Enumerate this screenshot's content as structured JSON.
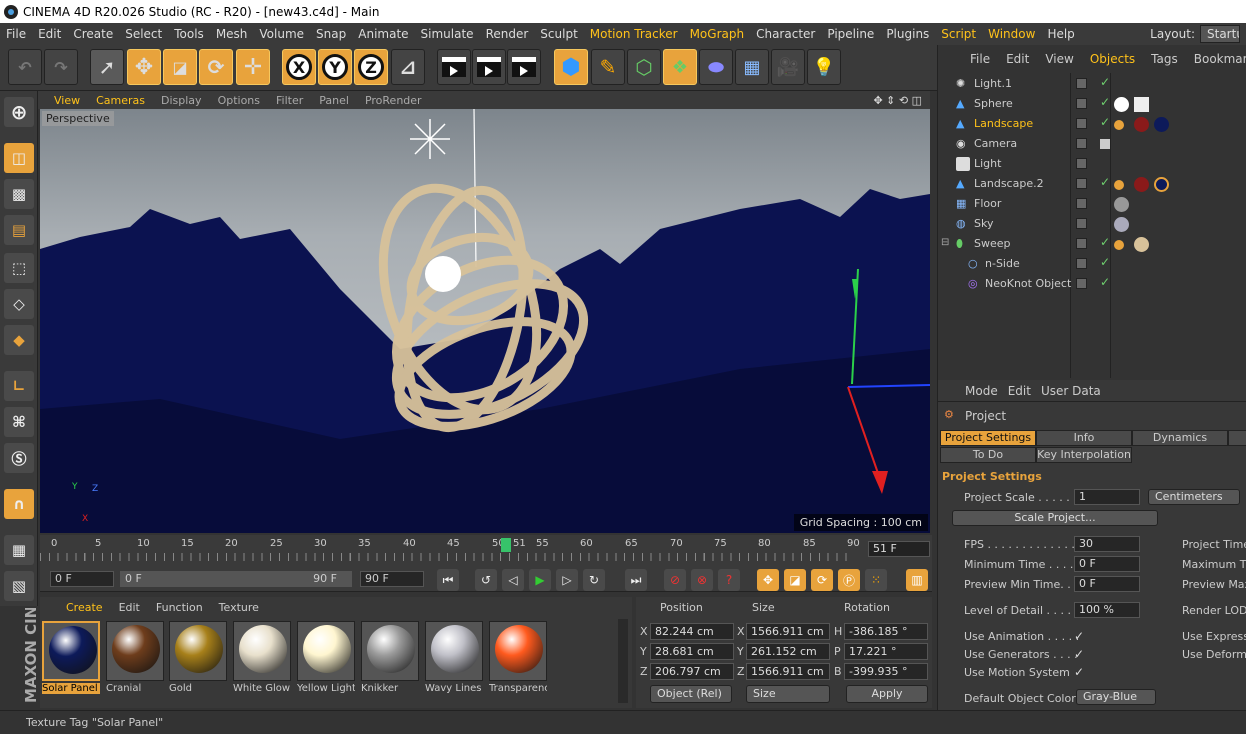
{
  "title": "CINEMA 4D R20.026 Studio (RC - R20) - [new43.c4d] - Main",
  "menu": [
    "File",
    "Edit",
    "Create",
    "Select",
    "Tools",
    "Mesh",
    "Volume",
    "Snap",
    "Animate",
    "Simulate",
    "Render",
    "Sculpt",
    "Motion Tracker",
    "MoGraph",
    "Character",
    "Pipeline",
    "Plugins",
    "Script",
    "Window",
    "Help"
  ],
  "layout": {
    "label": "Layout:",
    "value": "Startup"
  },
  "toolbar_axes": [
    "X",
    "Y",
    "Z"
  ],
  "viewport": {
    "menu": [
      "View",
      "Cameras",
      "Display",
      "Options",
      "Filter",
      "Panel",
      "ProRender"
    ],
    "camera": "Perspective",
    "grid_spacing": "Grid Spacing : 100 cm"
  },
  "timeline": {
    "ticks": [
      "0",
      "5",
      "10",
      "15",
      "20",
      "25",
      "30",
      "35",
      "40",
      "45",
      "50",
      "51",
      "55",
      "60",
      "65",
      "70",
      "75",
      "80",
      "85",
      "90"
    ],
    "current": "51 F",
    "start": "0 F",
    "slider_start": "0 F",
    "slider_end": "90 F",
    "end": "90 F"
  },
  "materials": {
    "menu": [
      "Create",
      "Edit",
      "Function",
      "Texture"
    ],
    "items": [
      {
        "name": "Solar Panel",
        "color": "#0d1a5a"
      },
      {
        "name": "Cranial",
        "color": "#6e3d1c"
      },
      {
        "name": "Gold",
        "color": "#a7801a"
      },
      {
        "name": "White Glow",
        "color": "#e8e0cc"
      },
      {
        "name": "Yellow Light",
        "color": "#fff6d0"
      },
      {
        "name": "Knikker",
        "color": "#9b9b9b"
      },
      {
        "name": "Wavy Lines",
        "color": "#c0c0c8"
      },
      {
        "name": "Transparency",
        "color": "#ff5a1e"
      }
    ]
  },
  "coords": {
    "headers": [
      "Position",
      "Size",
      "Rotation"
    ],
    "rows": [
      {
        "axis": "X",
        "pos": "82.244 cm",
        "saxis": "X",
        "size": "1566.911 cm",
        "raxis": "H",
        "rot": "-386.185 °"
      },
      {
        "axis": "Y",
        "pos": "28.681 cm",
        "saxis": "Y",
        "size": "261.152 cm",
        "raxis": "P",
        "rot": "17.221 °"
      },
      {
        "axis": "Z",
        "pos": "206.797 cm",
        "saxis": "Z",
        "size": "1566.911 cm",
        "raxis": "B",
        "rot": "-399.935 °"
      }
    ],
    "mode": "Object (Rel)",
    "size_mode": "Size",
    "apply": "Apply"
  },
  "objects": {
    "menu": [
      "File",
      "Edit",
      "View",
      "Objects",
      "Tags",
      "Bookmarks"
    ],
    "items": [
      {
        "name": "Light.1",
        "indent": 0
      },
      {
        "name": "Sphere",
        "indent": 0
      },
      {
        "name": "Landscape",
        "indent": 0
      },
      {
        "name": "Camera",
        "indent": 0
      },
      {
        "name": "Light",
        "indent": 0
      },
      {
        "name": "Landscape.2",
        "indent": 0
      },
      {
        "name": "Floor",
        "indent": 0
      },
      {
        "name": "Sky",
        "indent": 0
      },
      {
        "name": "Sweep",
        "indent": 0
      },
      {
        "name": "n-Side",
        "indent": 1
      },
      {
        "name": "NeoKnot Object",
        "indent": 1
      }
    ]
  },
  "attributes": {
    "menu": [
      "Mode",
      "Edit",
      "User Data"
    ],
    "object": "Project",
    "tabs": [
      "Project Settings",
      "Info",
      "Dynamics",
      "To Do",
      "Key Interpolation"
    ],
    "section": "Project Settings",
    "project_scale_label": "Project Scale . . . . . . .",
    "project_scale": "1",
    "units": "Centimeters",
    "scale_button": "Scale Project...",
    "fps_label": "FPS . . . . . . . . . . . . . .",
    "fps": "30",
    "min_time_label": "Minimum Time . . . . . . .",
    "min_time": "0 F",
    "preview_min_label": "Preview Min Time. . . . .",
    "preview_min": "0 F",
    "project_time": "Project Time",
    "max_time": "Maximum Tim",
    "preview_max": "Preview Max",
    "lod_label": "Level of Detail . . . . .",
    "lod": "100 %",
    "render_lod": "Render LOD",
    "use_animation": "Use Animation . . . . .",
    "use_generators": "Use Generators . . . .",
    "use_motion": "Use Motion System",
    "use_expr": "Use Expressi",
    "use_deform": "Use Deforme",
    "default_color_label": "Default Object Color",
    "default_color": "Gray-Blue"
  },
  "status": "Texture Tag \"Solar Panel\""
}
